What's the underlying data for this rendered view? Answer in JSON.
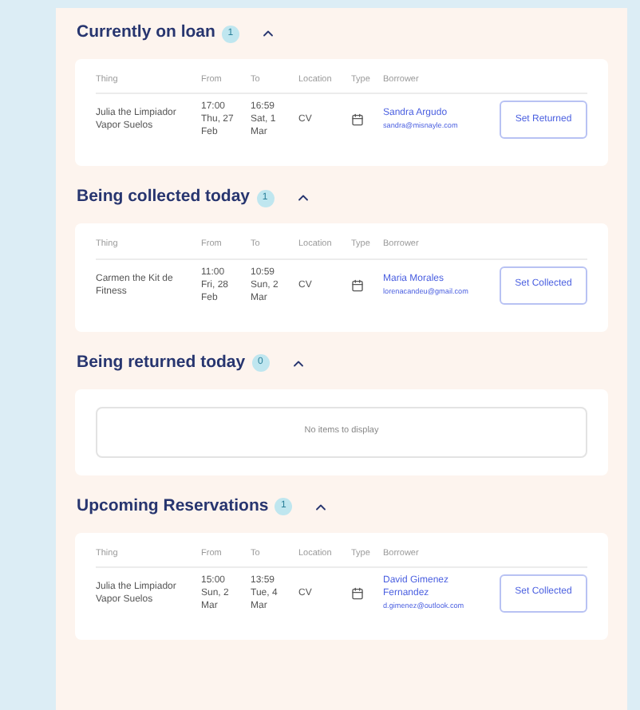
{
  "sections": [
    {
      "title": "Currently on loan",
      "count": "1",
      "expanded": true,
      "columns": [
        "Thing",
        "From",
        "To",
        "Location",
        "Type",
        "Borrower"
      ],
      "rows": [
        {
          "thing": "Julia the Limpiador Vapor Suelos",
          "from": [
            "17:00",
            "Thu, 27",
            "Feb"
          ],
          "to": [
            "16:59",
            "Sat, 1",
            "Mar"
          ],
          "location": "CV",
          "borrower_name": "Sandra Argudo",
          "borrower_email": "sandra@misnayle.com",
          "action": "Set Returned"
        }
      ]
    },
    {
      "title": "Being collected today",
      "count": "1",
      "expanded": true,
      "columns": [
        "Thing",
        "From",
        "To",
        "Location",
        "Type",
        "Borrower"
      ],
      "rows": [
        {
          "thing": "Carmen the Kit de Fitness",
          "from": [
            "11:00",
            "Fri, 28",
            "Feb"
          ],
          "to": [
            "10:59",
            "Sun, 2",
            "Mar"
          ],
          "location": "CV",
          "borrower_name": "Maria Morales",
          "borrower_email": "lorenacandeu@gmail.com",
          "action": "Set Collected"
        }
      ]
    },
    {
      "title": "Being returned today",
      "count": "0",
      "expanded": true,
      "empty_message": "No items to display"
    },
    {
      "title": "Upcoming Reservations",
      "count": "1",
      "expanded": true,
      "columns": [
        "Thing",
        "From",
        "To",
        "Location",
        "Type",
        "Borrower"
      ],
      "rows": [
        {
          "thing": "Julia the Limpiador Vapor Suelos",
          "from": [
            "15:00",
            "Sun, 2",
            "Mar"
          ],
          "to": [
            "13:59",
            "Tue, 4",
            "Mar"
          ],
          "location": "CV",
          "borrower_name": "David Gimenez Fernandez",
          "borrower_email": "d.gimenez@outlook.com",
          "action": "Set Collected"
        }
      ]
    }
  ]
}
